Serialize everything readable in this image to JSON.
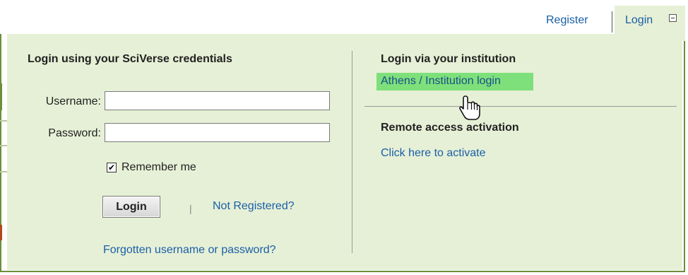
{
  "topbar": {
    "register_label": "Register",
    "login_tab_label": "Login",
    "collapse_icon": "minus-box-icon"
  },
  "left": {
    "heading": "Login using your SciVerse credentials",
    "username_label": "Username:",
    "username_value": "",
    "password_label": "Password:",
    "password_value": "",
    "remember_label": "Remember me",
    "remember_checked": true,
    "remember_check_glyph": "✔",
    "login_button_label": "Login",
    "separator": "|",
    "not_registered_label": "Not Registered?",
    "forgot_label": "Forgotten username or password?"
  },
  "right": {
    "institution_heading": "Login via your institution",
    "athens_link": "Athens / Institution login",
    "remote_heading": "Remote access activation",
    "activate_link": "Click here to activate"
  },
  "colors": {
    "panel_bg": "#e6f0d6",
    "link": "#1a5fa8",
    "highlight": "#7ee07a",
    "border": "#6b8e3a"
  },
  "cursor_icon": "hand-pointer-icon"
}
